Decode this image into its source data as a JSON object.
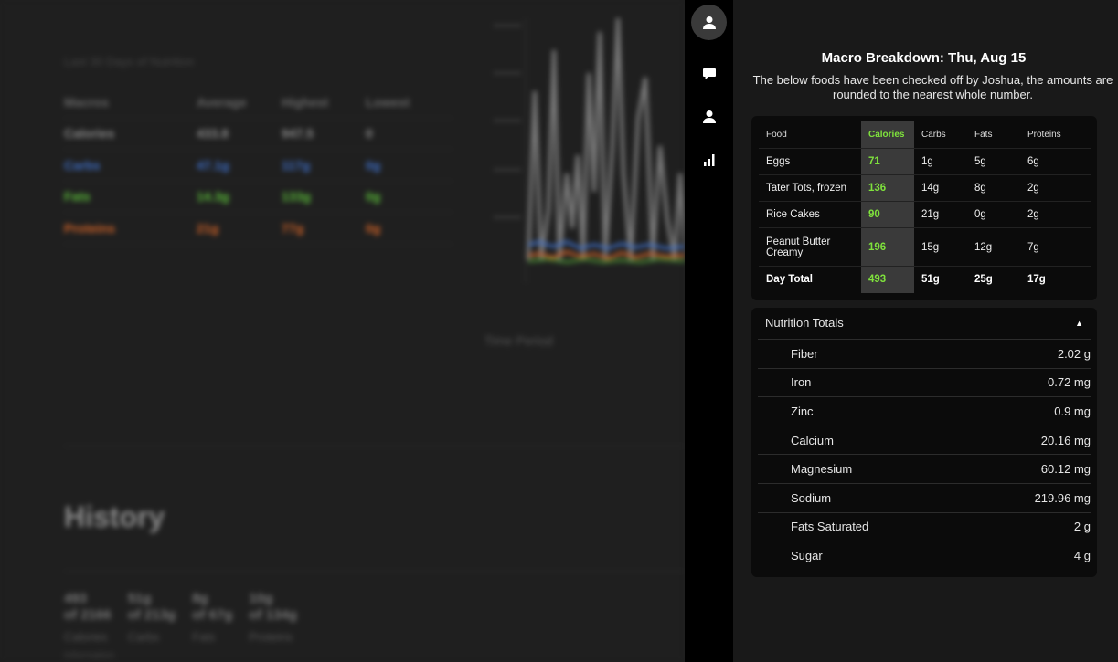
{
  "background": {
    "subtitle": "Last 30 Days of Nutrition",
    "stats_headers": [
      "Macros",
      "Average",
      "Highest",
      "Lowest"
    ],
    "stats_rows": [
      {
        "name": "Calories",
        "avg": "433.8",
        "high": "947.5",
        "low": "0",
        "color": "#8a8a8a"
      },
      {
        "name": "Carbs",
        "avg": "47.1g",
        "high": "117g",
        "low": "0g",
        "color": "#3f6fc7"
      },
      {
        "name": "Fats",
        "avg": "14.3g",
        "high": "133g",
        "low": "0g",
        "color": "#5cbf3a"
      },
      {
        "name": "Proteins",
        "avg": "21g",
        "high": "77g",
        "low": "0g",
        "color": "#d06328"
      }
    ],
    "chart_xlabel": "Time Period",
    "history_title": "History",
    "history_stats": [
      {
        "value": "493",
        "target": "of 2166",
        "label": "Calories"
      },
      {
        "value": "51g",
        "target": "of 213g",
        "label": "Carbs"
      },
      {
        "value": "8g",
        "target": "of 67g",
        "label": "Fats"
      },
      {
        "value": "10g",
        "target": "of 134g",
        "label": "Proteins"
      }
    ],
    "footer_note": "Information"
  },
  "rail": {
    "items": [
      {
        "name": "profile",
        "icon": "user-icon",
        "active": true
      },
      {
        "name": "messages",
        "icon": "chat-icon",
        "active": false
      },
      {
        "name": "user",
        "icon": "user-icon",
        "active": false
      },
      {
        "name": "stats",
        "icon": "bar-chart-icon",
        "active": false
      }
    ]
  },
  "panel": {
    "title": "Macro Breakdown: Thu, Aug 15",
    "description": "The below foods have been checked off by Joshua, the amounts are rounded to the nearest whole number.",
    "macro_table": {
      "headers": [
        "Food",
        "Calories",
        "Carbs",
        "Fats",
        "Proteins"
      ],
      "rows": [
        {
          "food": "Eggs",
          "calories": "71",
          "carbs": "1g",
          "fats": "5g",
          "proteins": "6g"
        },
        {
          "food": "Tater Tots, frozen",
          "calories": "136",
          "carbs": "14g",
          "fats": "8g",
          "proteins": "2g"
        },
        {
          "food": "Rice Cakes",
          "calories": "90",
          "carbs": "21g",
          "fats": "0g",
          "proteins": "2g"
        },
        {
          "food": "Peanut Butter Creamy",
          "calories": "196",
          "carbs": "15g",
          "fats": "12g",
          "proteins": "7g"
        }
      ],
      "total": {
        "food": "Day Total",
        "calories": "493",
        "carbs": "51g",
        "fats": "25g",
        "proteins": "17g"
      }
    },
    "nutrition": {
      "title": "Nutrition Totals",
      "toggle": "▲",
      "items": [
        {
          "label": "Fiber",
          "value": "2.02 g"
        },
        {
          "label": "Iron",
          "value": "0.72 mg"
        },
        {
          "label": "Zinc",
          "value": "0.9 mg"
        },
        {
          "label": "Calcium",
          "value": "20.16 mg"
        },
        {
          "label": "Magnesium",
          "value": "60.12 mg"
        },
        {
          "label": "Sodium",
          "value": "219.96 mg"
        },
        {
          "label": "Fats Saturated",
          "value": "2 g"
        },
        {
          "label": "Sugar",
          "value": "4 g"
        }
      ]
    }
  },
  "colors": {
    "calories_accent": "#7fe23c",
    "panel_bg": "#191919",
    "card_bg": "#0b0b0b",
    "rail_bg": "#000000"
  }
}
